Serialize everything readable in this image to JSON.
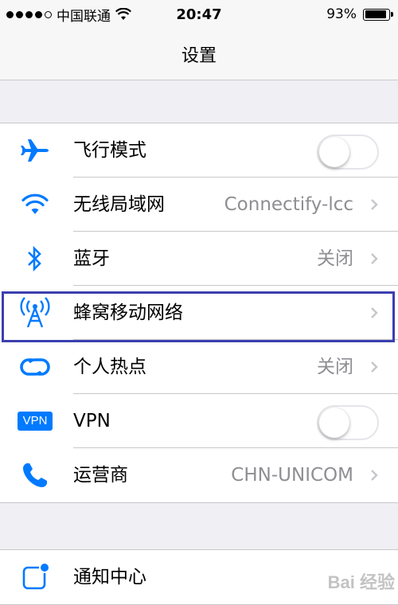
{
  "status_bar": {
    "carrier": "中国联通",
    "time": "20:47",
    "battery_percent": "93%",
    "battery_level": 0.93,
    "signal_filled": 4,
    "signal_total": 5
  },
  "nav": {
    "title": "设置"
  },
  "group1": {
    "rows": [
      {
        "label": "飞行模式",
        "icon": "airplane-icon",
        "toggle": false
      },
      {
        "label": "无线局域网",
        "icon": "wifi-icon",
        "value": "Connectify-lcc"
      },
      {
        "label": "蓝牙",
        "icon": "bluetooth-icon",
        "value": "关闭"
      },
      {
        "label": "蜂窝移动网络",
        "icon": "cellular-antenna-icon",
        "value": ""
      },
      {
        "label": "个人热点",
        "icon": "hotspot-icon",
        "value": "关闭"
      },
      {
        "label": "VPN",
        "icon": "vpn-icon",
        "badge": "VPN",
        "toggle": false
      },
      {
        "label": "运营商",
        "icon": "phone-icon",
        "value": "CHN-UNICOM"
      }
    ]
  },
  "group2": {
    "rows": [
      {
        "label": "通知中心",
        "icon": "notification-center-icon"
      }
    ]
  },
  "colors": {
    "accent": "#007aff",
    "highlight": "#3b3fb0",
    "separator": "#c8c7cc",
    "value_gray": "#8e8e93"
  },
  "watermark": "Bai 经验"
}
